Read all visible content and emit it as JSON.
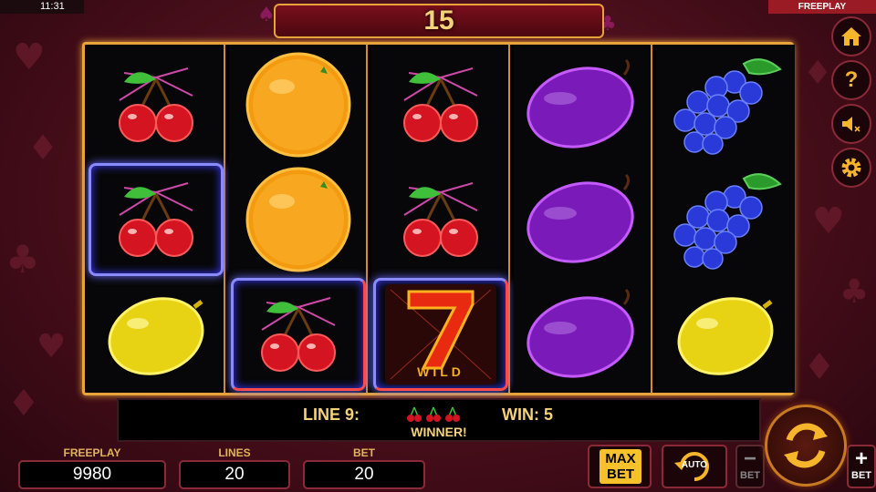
{
  "status_bar": {
    "time": "11:31",
    "mode": "FREEPLAY"
  },
  "header": {
    "value": "15"
  },
  "side_buttons": [
    {
      "name": "home-icon"
    },
    {
      "name": "help-icon",
      "glyph": "?"
    },
    {
      "name": "sound-off-icon"
    },
    {
      "name": "settings-icon"
    }
  ],
  "reels": [
    [
      "cherries",
      "cherries",
      "lemon"
    ],
    [
      "orange",
      "orange",
      "cherries"
    ],
    [
      "cherries",
      "cherries",
      "wild-seven"
    ],
    [
      "plum",
      "plum",
      "plum"
    ],
    [
      "grapes",
      "grapes",
      "lemon"
    ]
  ],
  "winning_line": {
    "label": "LINE 9:",
    "win": "WIN: 5",
    "message": "WINNER!",
    "symbol_count": 3
  },
  "meters": {
    "freeplay": {
      "label": "FREEPLAY",
      "value": "9980"
    },
    "lines": {
      "label": "LINES",
      "value": "20"
    },
    "bet": {
      "label": "BET",
      "value": "20"
    }
  },
  "buttons": {
    "max_bet_line1": "MAX",
    "max_bet_line2": "BET",
    "auto": "AUTO",
    "bet_minus_symbol": "−",
    "bet_minus_label": "BET",
    "bet_plus_symbol": "+",
    "bet_plus_label": "BET"
  },
  "wild_label": "WILD",
  "colors": {
    "frame": "#e8a33b",
    "accent_gold": "#f4d27a",
    "win_highlight": "#8a8aff"
  }
}
